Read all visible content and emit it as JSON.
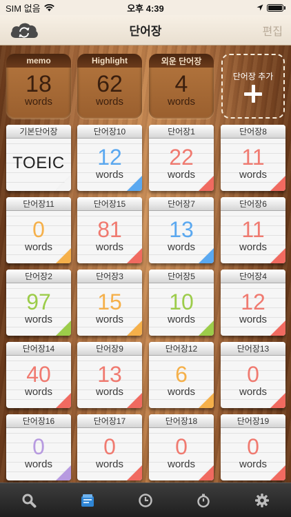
{
  "status": {
    "carrier": "SIM 없음",
    "time": "오후 4:39"
  },
  "nav": {
    "title": "단어장",
    "edit": "편집"
  },
  "counters": [
    {
      "label": "memo",
      "count": "18",
      "unit": "words"
    },
    {
      "label": "Highlight",
      "count": "62",
      "unit": "words"
    },
    {
      "label": "외운 단어장",
      "count": "4",
      "unit": "words"
    }
  ],
  "add": {
    "label": "단어장 추가"
  },
  "cards": [
    {
      "title": "기본단어장",
      "count": "TOEIC",
      "unit": "",
      "color": "#222222",
      "corner": "#f4f4f4"
    },
    {
      "title": "단어장10",
      "count": "12",
      "unit": "words",
      "color": "#5aa8f0",
      "corner": "#5aa8f0"
    },
    {
      "title": "단어장1",
      "count": "22",
      "unit": "words",
      "color": "#f07a70",
      "corner": "#f06a60"
    },
    {
      "title": "단어장8",
      "count": "11",
      "unit": "words",
      "color": "#f07a70",
      "corner": "#f06a60"
    },
    {
      "title": "단어장11",
      "count": "0",
      "unit": "words",
      "color": "#f5b04a",
      "corner": "#f5b04a"
    },
    {
      "title": "단어장15",
      "count": "81",
      "unit": "words",
      "color": "#f07a70",
      "corner": "#f06a60"
    },
    {
      "title": "단어장7",
      "count": "13",
      "unit": "words",
      "color": "#5aa8f0",
      "corner": "#5aa8f0"
    },
    {
      "title": "단어장6",
      "count": "11",
      "unit": "words",
      "color": "#f07a70",
      "corner": "#f06a60"
    },
    {
      "title": "단어장2",
      "count": "97",
      "unit": "words",
      "color": "#9ccc4a",
      "corner": "#9ccc4a"
    },
    {
      "title": "단어장3",
      "count": "15",
      "unit": "words",
      "color": "#f5b04a",
      "corner": "#f5b04a"
    },
    {
      "title": "단어장5",
      "count": "10",
      "unit": "words",
      "color": "#9ccc4a",
      "corner": "#9ccc4a"
    },
    {
      "title": "단어장4",
      "count": "12",
      "unit": "words",
      "color": "#f07a70",
      "corner": "#f06a60"
    },
    {
      "title": "단어장14",
      "count": "40",
      "unit": "words",
      "color": "#f07a70",
      "corner": "#f06a60"
    },
    {
      "title": "단어장9",
      "count": "13",
      "unit": "words",
      "color": "#f07a70",
      "corner": "#f06a60"
    },
    {
      "title": "단어장12",
      "count": "6",
      "unit": "words",
      "color": "#f5b04a",
      "corner": "#f5b04a"
    },
    {
      "title": "단어장13",
      "count": "0",
      "unit": "words",
      "color": "#f07a70",
      "corner": "#f06a60"
    },
    {
      "title": "단어장16",
      "count": "0",
      "unit": "words",
      "color": "#b79ae0",
      "corner": "#b79ae0"
    },
    {
      "title": "단어장17",
      "count": "0",
      "unit": "words",
      "color": "#f07a70",
      "corner": "#f06a60"
    },
    {
      "title": "단어장18",
      "count": "0",
      "unit": "words",
      "color": "#f07a70",
      "corner": "#f06a60"
    },
    {
      "title": "단어장19",
      "count": "0",
      "unit": "words",
      "color": "#f07a70",
      "corner": "#f06a60"
    }
  ],
  "tabs": [
    {
      "icon": "search-icon"
    },
    {
      "icon": "wordbook-icon",
      "active": true
    },
    {
      "icon": "clock-icon"
    },
    {
      "icon": "stopwatch-icon"
    },
    {
      "icon": "gear-icon"
    }
  ]
}
